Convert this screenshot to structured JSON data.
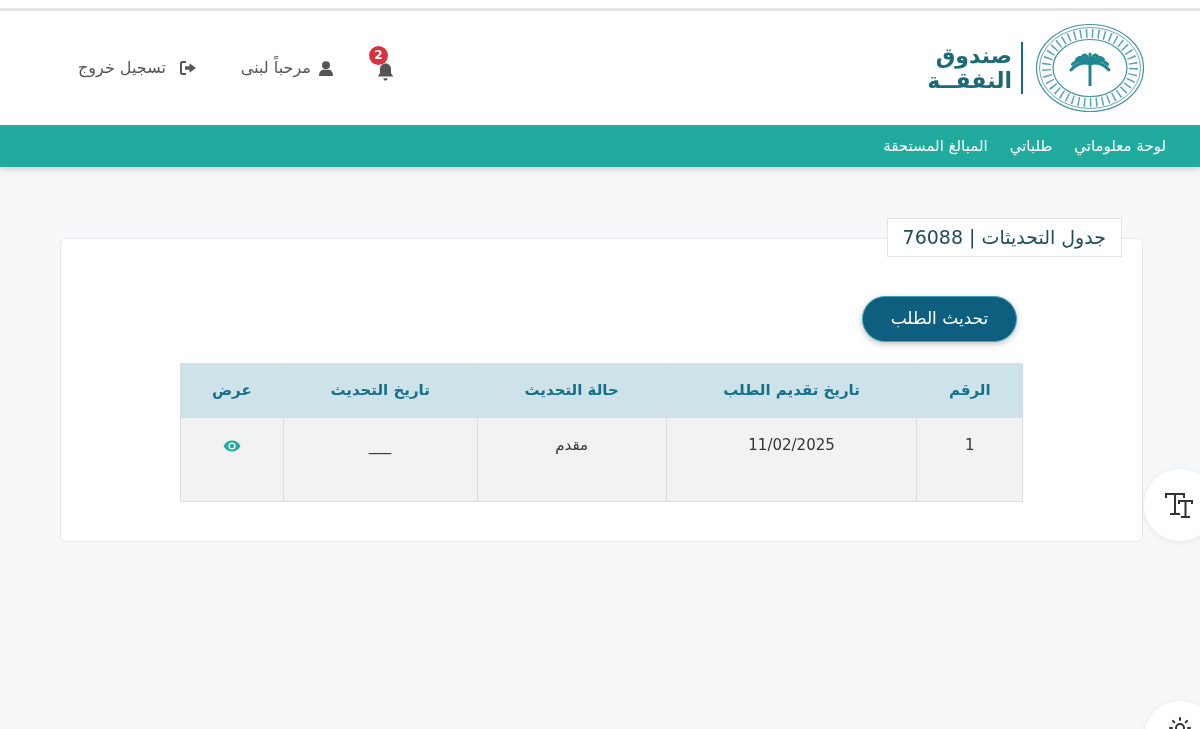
{
  "header": {
    "logo": {
      "line_1": "صندوق",
      "line_2": "النفقــة"
    },
    "notifications": {
      "count": "2"
    },
    "user": {
      "greeting": "مرحباً لبنى"
    },
    "logout": {
      "label": "تسجيل خروج"
    }
  },
  "nav": {
    "items": [
      {
        "label": "لوحة معلوماتي"
      },
      {
        "label": "طلباتي"
      },
      {
        "label": "المبالغ المستحقة"
      }
    ]
  },
  "panel": {
    "title": "جدول التحديثات | 76088",
    "update_button": "تحديث الطلب",
    "table": {
      "columns": [
        "الرقم",
        "تاريخ تقديم الطلب",
        "حالة التحديث",
        "تاريخ التحديث",
        "عرض"
      ],
      "rows": [
        {
          "number": "1",
          "submitted": "11/02/2025",
          "status": "مقدم",
          "updated": "___"
        }
      ]
    }
  }
}
